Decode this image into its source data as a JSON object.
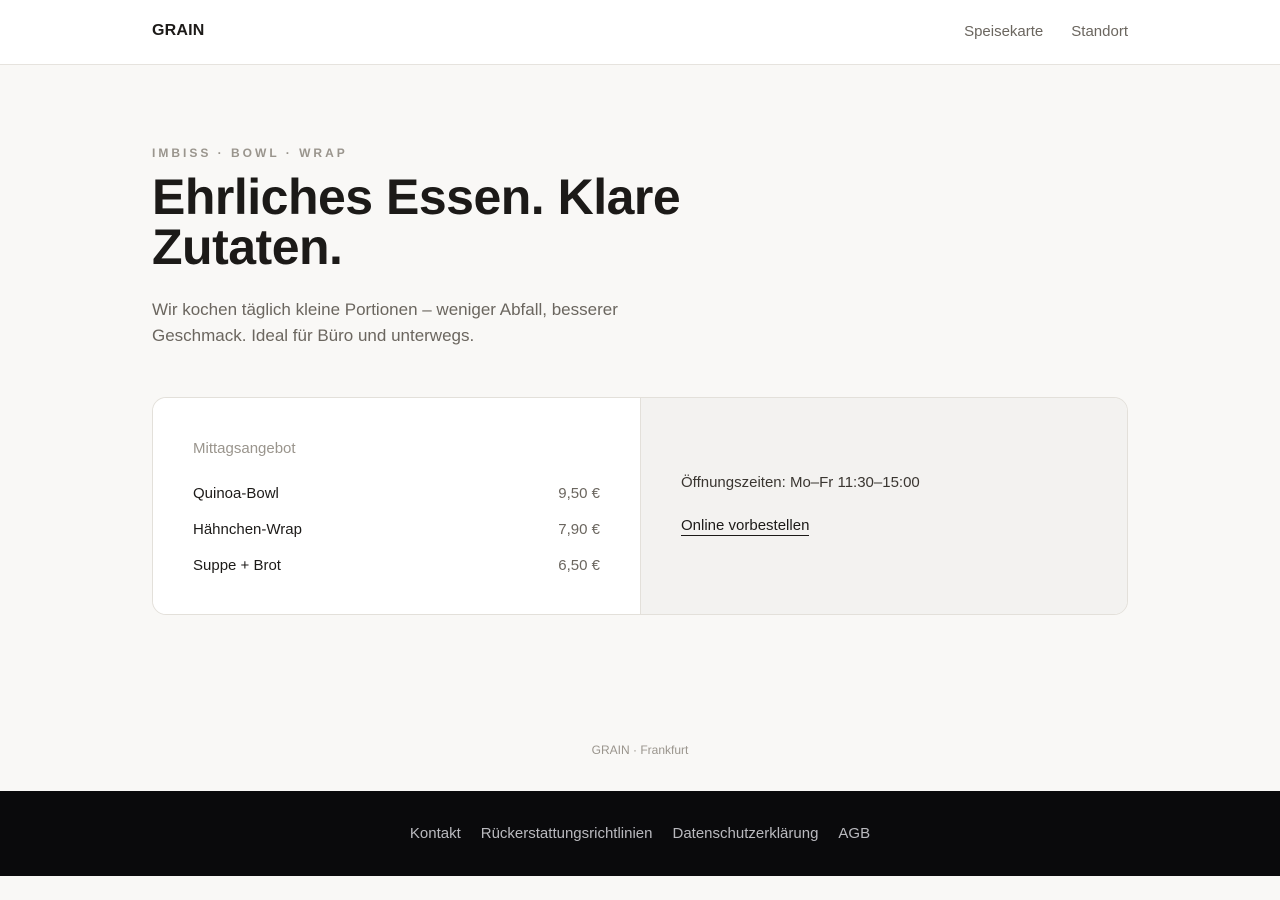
{
  "header": {
    "brand": "GRAIN",
    "nav": [
      "Speisekarte",
      "Standort"
    ]
  },
  "hero": {
    "kicker": "IMBISS · BOWL · WRAP",
    "headline": "Ehrliches Essen. Klare Zutaten.",
    "lead": "Wir kochen täglich kleine Portionen – weniger Abfall, besserer Geschmack. Ideal für Büro und unterwegs."
  },
  "card": {
    "title": "Mittagsangebot",
    "items": [
      {
        "name": "Quinoa-Bowl",
        "price": "9,50 €"
      },
      {
        "name": "Hähnchen-Wrap",
        "price": "7,90 €"
      },
      {
        "name": "Suppe + Brot",
        "price": "6,50 €"
      }
    ],
    "hours": "Öffnungszeiten: Mo–Fr 11:30–15:00",
    "order_link": "Online vorbestellen"
  },
  "footer": {
    "note": "GRAIN · Frankfurt",
    "links": [
      "Kontakt",
      "Rückerstattungsrichtlinien",
      "Datenschutzerklärung",
      "AGB"
    ]
  },
  "colors": {
    "page_bg": "#f9f8f6",
    "text": "#1c1a18",
    "muted": "#6b665f",
    "footer_bg": "#0a0a0c"
  }
}
